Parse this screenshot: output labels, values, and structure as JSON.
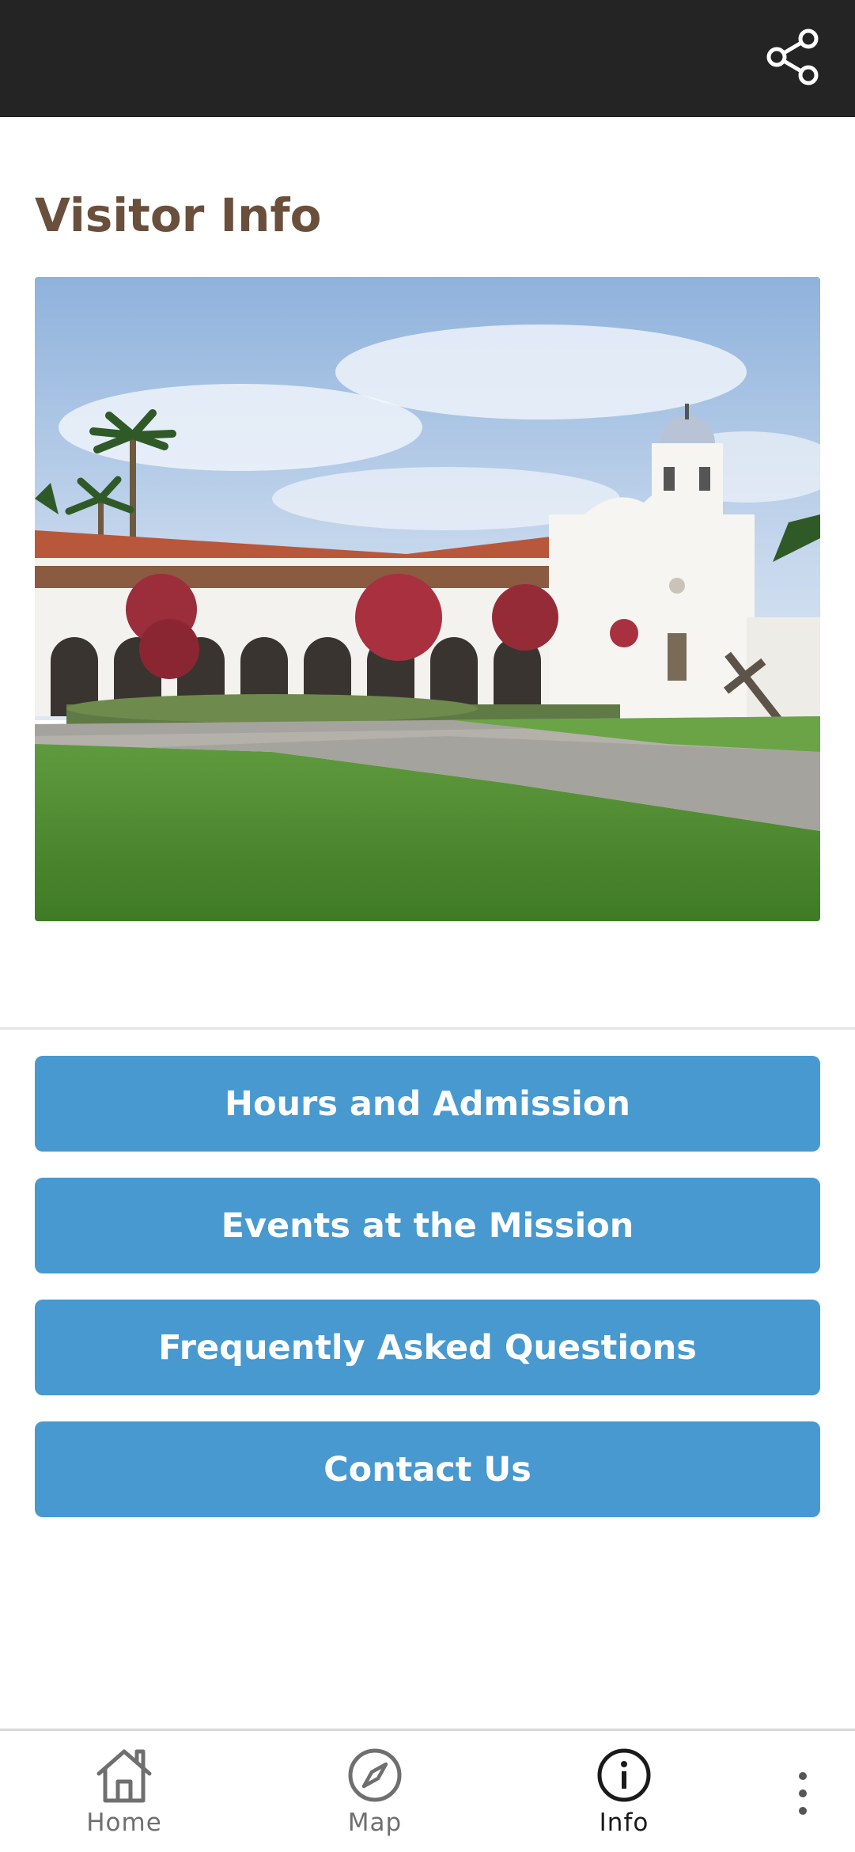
{
  "header": {
    "share_icon": "share-icon"
  },
  "page": {
    "title": "Visitor Info"
  },
  "buttons": {
    "hours": "Hours and Admission",
    "events": "Events at the Mission",
    "faq": "Frequently Asked Questions",
    "contact": "Contact Us"
  },
  "nav": {
    "home": "Home",
    "map": "Map",
    "info": "Info",
    "active": "info",
    "more_icon": "more-vertical-icon"
  },
  "colors": {
    "topbar": "#242424",
    "title": "#6a4f3c",
    "button": "#4799d0",
    "nav_active": "#1a1a1a",
    "nav_inactive": "#6f6f6f"
  }
}
